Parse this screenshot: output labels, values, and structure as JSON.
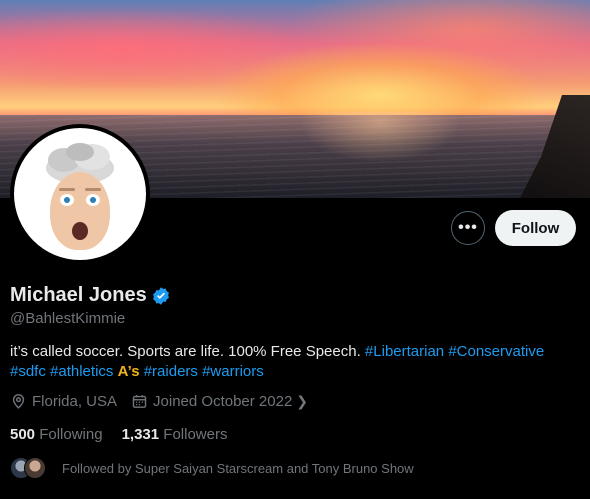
{
  "profile": {
    "name": "Michael Jones",
    "handle": "@BahlestKimmie",
    "bio": {
      "text": "it’s called soccer. Sports are life. 100% Free Speech.",
      "tags_line1": [
        "#Libertarian",
        "#Conservative"
      ],
      "tags_line2a": [
        "#sdfc",
        "#athletics"
      ],
      "emoji": "A’s",
      "tags_line2b": [
        "#raiders",
        "#warriors"
      ]
    },
    "location": "Florida, USA",
    "joined": "Joined October 2022",
    "following_count": "500",
    "following_label": "Following",
    "followers_count": "1,331",
    "followers_label": "Followers",
    "followed_by": "Followed by Super Saiyan Starscream and Tony Bruno Show"
  },
  "actions": {
    "more_label": "•••",
    "follow_label": "Follow"
  },
  "icons": {
    "verified": "verified-badge-icon",
    "location": "location-pin-icon",
    "calendar": "calendar-icon",
    "chevron": "chevron-right-icon"
  },
  "colors": {
    "accent": "#1d9bf0",
    "muted": "#71767b",
    "text": "#e7e9ea",
    "follow_bg": "#eff3f4"
  }
}
